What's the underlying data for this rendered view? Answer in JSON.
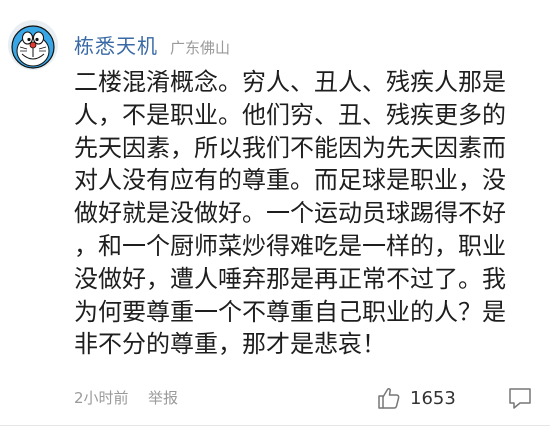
{
  "comment": {
    "author": "栋悉天机",
    "location": "广东佛山",
    "lines": [
      "二楼混淆概念。穷人、丑人、残疾人那是",
      "人，不是职业。他们穷、丑、残疾更多的",
      "先天因素，所以我们不能因为先天因素而",
      "对人没有应有的尊重。而足球是职业，没",
      "做好就是没做好。一个运动员球踢得不好",
      "，和一个厨师菜炒得难吃是一样的，职业",
      "没做好，遭人唾弃那是再正常不过了。我",
      "为何要尊重一个不尊重自己职业的人？是",
      "非不分的尊重，那才是悲哀！"
    ],
    "time": "2小时前",
    "report_label": "举报",
    "likes": "1653"
  },
  "icons": {
    "avatar": "doraemon-avatar",
    "like": "thumbs-up-icon",
    "reply": "reply-bubble-icon"
  },
  "colors": {
    "username": "#3a6aa6",
    "meta": "#9a9a9a",
    "text": "#1e1e1e"
  }
}
